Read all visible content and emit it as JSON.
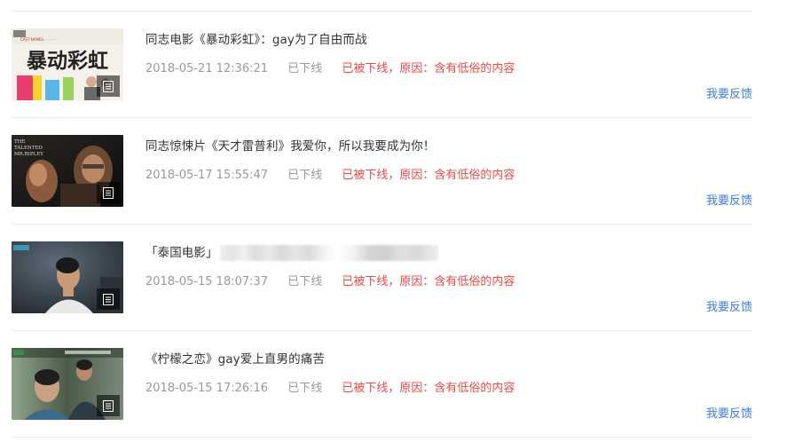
{
  "items": [
    {
      "title": "同志电影《暴动彩虹》：gay为了自由而战",
      "datetime": "2018-05-21 12:36:21",
      "status": "已下线",
      "reason": "已被下线，原因：含有低俗的内容",
      "feedback": "我要反馈",
      "thumb_text": "暴动彩虹",
      "thumb_icon": "article-icon"
    },
    {
      "title": "同志惊悚片《天才雷普利》我爱你，所以我要成为你！",
      "datetime": "2018-05-17 15:55:47",
      "status": "已下线",
      "reason": "已被下线，原因：含有低俗的内容",
      "feedback": "我要反馈",
      "thumb_text": "THE TALENTED MR. RIPLEY",
      "thumb_icon": "article-icon"
    },
    {
      "title": "「泰国电影」",
      "datetime": "2018-05-15 18:07:37",
      "status": "已下线",
      "reason": "已被下线，原因：含有低俗的内容",
      "feedback": "我要反馈",
      "thumb_icon": "article-icon"
    },
    {
      "title": "《柠檬之恋》gay爱上直男的痛苦",
      "datetime": "2018-05-15 17:26:16",
      "status": "已下线",
      "reason": "已被下线，原因：含有低俗的内容",
      "feedback": "我要反馈",
      "thumb_icon": "article-icon"
    }
  ],
  "colors": {
    "title": "#333333",
    "meta": "#999999",
    "reason": "#e84a4a",
    "link": "#3b7dd8",
    "divider": "#e8e8e8"
  }
}
